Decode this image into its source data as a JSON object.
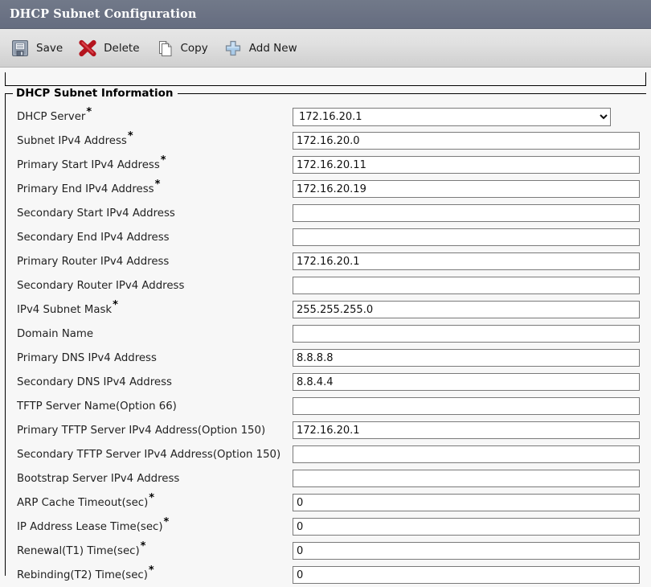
{
  "window": {
    "title": "DHCP Subnet Configuration"
  },
  "toolbar": {
    "buttons": [
      {
        "label": "Save",
        "icon": "save-floppy-icon"
      },
      {
        "label": "Delete",
        "icon": "delete-cross-icon"
      },
      {
        "label": "Copy",
        "icon": "copy-pages-icon"
      },
      {
        "label": "Add New",
        "icon": "add-plus-icon"
      }
    ]
  },
  "form": {
    "legend": "DHCP Subnet Information",
    "required_marker": "*",
    "fields": [
      {
        "label": "DHCP Server",
        "required": true,
        "type": "select",
        "value": "172.16.20.1",
        "options": [
          "172.16.20.1"
        ]
      },
      {
        "label": "Subnet IPv4 Address",
        "required": true,
        "type": "text",
        "value": "172.16.20.0"
      },
      {
        "label": "Primary Start IPv4 Address",
        "required": true,
        "type": "text",
        "value": "172.16.20.11"
      },
      {
        "label": "Primary End IPv4 Address",
        "required": true,
        "type": "text",
        "value": "172.16.20.19"
      },
      {
        "label": "Secondary Start IPv4 Address",
        "required": false,
        "type": "text",
        "value": ""
      },
      {
        "label": "Secondary End IPv4 Address",
        "required": false,
        "type": "text",
        "value": ""
      },
      {
        "label": "Primary Router IPv4 Address",
        "required": false,
        "type": "text",
        "value": "172.16.20.1"
      },
      {
        "label": "Secondary Router IPv4 Address",
        "required": false,
        "type": "text",
        "value": ""
      },
      {
        "label": "IPv4 Subnet Mask",
        "required": true,
        "type": "text",
        "value": "255.255.255.0"
      },
      {
        "label": "Domain Name",
        "required": false,
        "type": "text",
        "value": ""
      },
      {
        "label": "Primary DNS IPv4 Address",
        "required": false,
        "type": "text",
        "value": "8.8.8.8"
      },
      {
        "label": "Secondary DNS IPv4 Address",
        "required": false,
        "type": "text",
        "value": "8.8.4.4"
      },
      {
        "label": "TFTP Server Name(Option 66)",
        "required": false,
        "type": "text",
        "value": ""
      },
      {
        "label": "Primary TFTP Server IPv4 Address(Option 150)",
        "required": false,
        "type": "text",
        "value": "172.16.20.1"
      },
      {
        "label": "Secondary TFTP Server IPv4 Address(Option 150)",
        "required": false,
        "type": "text",
        "value": ""
      },
      {
        "label": "Bootstrap Server IPv4 Address",
        "required": false,
        "type": "text",
        "value": ""
      },
      {
        "label": "ARP Cache Timeout(sec)",
        "required": true,
        "type": "text",
        "value": "0"
      },
      {
        "label": "IP Address Lease Time(sec)",
        "required": true,
        "type": "text",
        "value": "0"
      },
      {
        "label": "Renewal(T1) Time(sec)",
        "required": true,
        "type": "text",
        "value": "0"
      },
      {
        "label": "Rebinding(T2) Time(sec)",
        "required": true,
        "type": "text",
        "value": "0"
      }
    ]
  },
  "colors": {
    "titlebar": "#6b7284",
    "toolbar_top": "#e6e6e6",
    "toolbar_bottom": "#cfcfcf",
    "page_background": "#f7f7f7",
    "delete_icon": "#b4141e",
    "add_icon": "#9fc4e6"
  }
}
